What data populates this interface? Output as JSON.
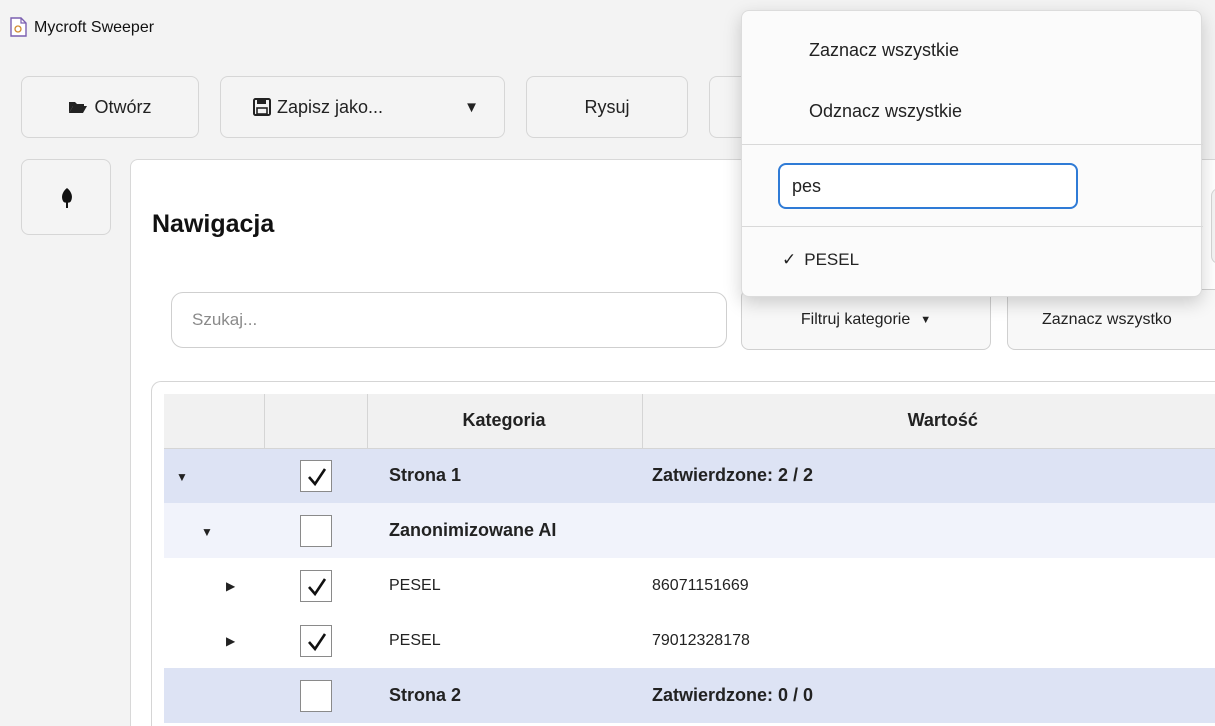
{
  "window": {
    "title": "Mycroft Sweeper",
    "icon": "document-icon"
  },
  "toolbar": {
    "open_label": "Otwórz",
    "open_icon": "folder-open-icon",
    "save_label": "Zapisz jako...",
    "save_icon": "floppy-disk-icon",
    "draw_label": "Rysuj"
  },
  "rail": {
    "tree_icon": "tree-icon"
  },
  "panel": {
    "title": "Nawigacja",
    "search_placeholder": "Szukaj...",
    "filter_label": "Filtruj kategorie",
    "select_all_label": "Zaznacz wszystko"
  },
  "table": {
    "columns": [
      "",
      "",
      "Kategoria",
      "Wartość"
    ],
    "rows": [
      {
        "level": 0,
        "expanded": true,
        "checked": true,
        "kategoria": "Strona 1",
        "wartosc": "Zatwierdzone: 2 / 2"
      },
      {
        "level": 1,
        "expanded": true,
        "checked": false,
        "kategoria": "Zanonimizowane AI",
        "wartosc": ""
      },
      {
        "level": 2,
        "expanded": false,
        "checked": true,
        "kategoria": "PESEL",
        "wartosc": "86071151669"
      },
      {
        "level": 2,
        "expanded": false,
        "checked": true,
        "kategoria": "PESEL",
        "wartosc": "79012328178"
      },
      {
        "level": 0,
        "expanded": false,
        "checked": false,
        "kategoria": "Strona 2",
        "wartosc": "Zatwierdzone: 0 / 0"
      }
    ]
  },
  "dropdown": {
    "select_all": "Zaznacz wszystkie",
    "deselect_all": "Odznacz wszystkie",
    "filter_value": "pes",
    "option_mark": "✓",
    "option_label": "PESEL"
  },
  "colors": {
    "accent": "#2f7bd6",
    "row_highlight": "#dde3f4",
    "row_alt": "#f1f3fb"
  }
}
